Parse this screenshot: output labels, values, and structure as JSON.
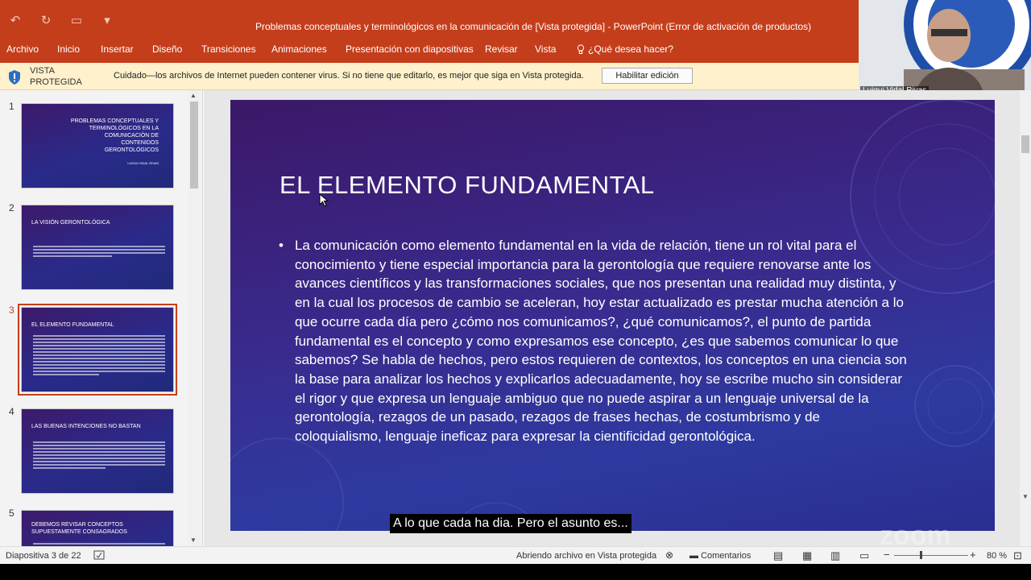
{
  "window": {
    "title": "Problemas conceptuales y terminológicos en la comunicación de [Vista protegida] - PowerPoint (Error de activación de productos)"
  },
  "quick_access": {
    "undo_icon": "undo-icon",
    "redo_icon": "redo-icon",
    "present_icon": "present-icon",
    "customize_icon": "customize-icon"
  },
  "ribbon": {
    "tabs": [
      "Archivo",
      "Inicio",
      "Insertar",
      "Diseño",
      "Transiciones",
      "Animaciones",
      "Presentación con diapositivas",
      "Revisar",
      "Vista"
    ],
    "tell_me": "¿Qué desea hacer?"
  },
  "protected_bar": {
    "label": "VISTA PROTEGIDA",
    "message": "Cuidado—los archivos de Internet pueden contener virus. Si no tiene que editarlo, es mejor que siga en Vista protegida.",
    "button": "Habilitar edición"
  },
  "webcam": {
    "name": "Luigui Vidal  Rivas"
  },
  "thumbnails": [
    {
      "num": "1",
      "title": "PROBLEMAS CONCEPTUALES Y TERMINOLÓGICOS EN LA COMUNICACIÓN DE CONTENIDOS GERONTOLÓGICOS",
      "subtitle": "LUIGUI VIDAL RIVAS"
    },
    {
      "num": "2",
      "title": "LA VISIÓN GERONTOLÓGICA"
    },
    {
      "num": "3",
      "title": "EL ELEMENTO FUNDAMENTAL",
      "selected": true
    },
    {
      "num": "4",
      "title": "LAS BUENAS INTENCIONES NO BASTAN"
    },
    {
      "num": "5",
      "title": "DEBEMOS REVISAR CONCEPTOS SUPUESTAMENTE CONSAGRADOS"
    }
  ],
  "slide": {
    "title": "EL ELEMENTO FUNDAMENTAL",
    "bullet": "•",
    "body": "La comunicación como elemento fundamental en la vida de relación, tiene un rol vital para el conocimiento y tiene especial importancia para la gerontología que requiere renovarse ante los avances científicos y las transformaciones sociales, que nos presentan una realidad muy distinta, y en la cual los procesos de cambio se aceleran, hoy estar actualizado es prestar mucha atención a lo que ocurre cada día pero ¿cómo nos comunicamos?, ¿qué comunicamos?, el punto de partida fundamental es el concepto y como expresamos ese concepto, ¿es que sabemos comunicar lo que sabemos? Se habla de hechos, pero estos requieren de contextos, los conceptos en una ciencia son la base para analizar los hechos y explicarlos adecuadamente, hoy se escribe mucho sin considerar el rigor y que expresa un lenguaje ambiguo que no puede aspirar a un lenguaje universal de la gerontología, rezagos de un pasado, rezagos de frases hechas, de costumbrismo y de coloquialismo, lenguaje ineficaz para expresar la cientificidad gerontológica."
  },
  "caption": "A lo que cada ha dia. Pero el asunto es...",
  "watermark": "zoom",
  "status": {
    "slide_info": "Diapositiva 3 de 22",
    "opening": "Abriendo archivo en Vista protegida",
    "comments": "Comentarios",
    "zoom": "80 %",
    "zoom_minus": "−",
    "zoom_plus": "+"
  },
  "colors": {
    "accent": "#c43e1c",
    "slide_bg_top": "#3b1868",
    "slide_bg_bottom": "#2a2e90",
    "protected_bar": "#fff1cc"
  }
}
